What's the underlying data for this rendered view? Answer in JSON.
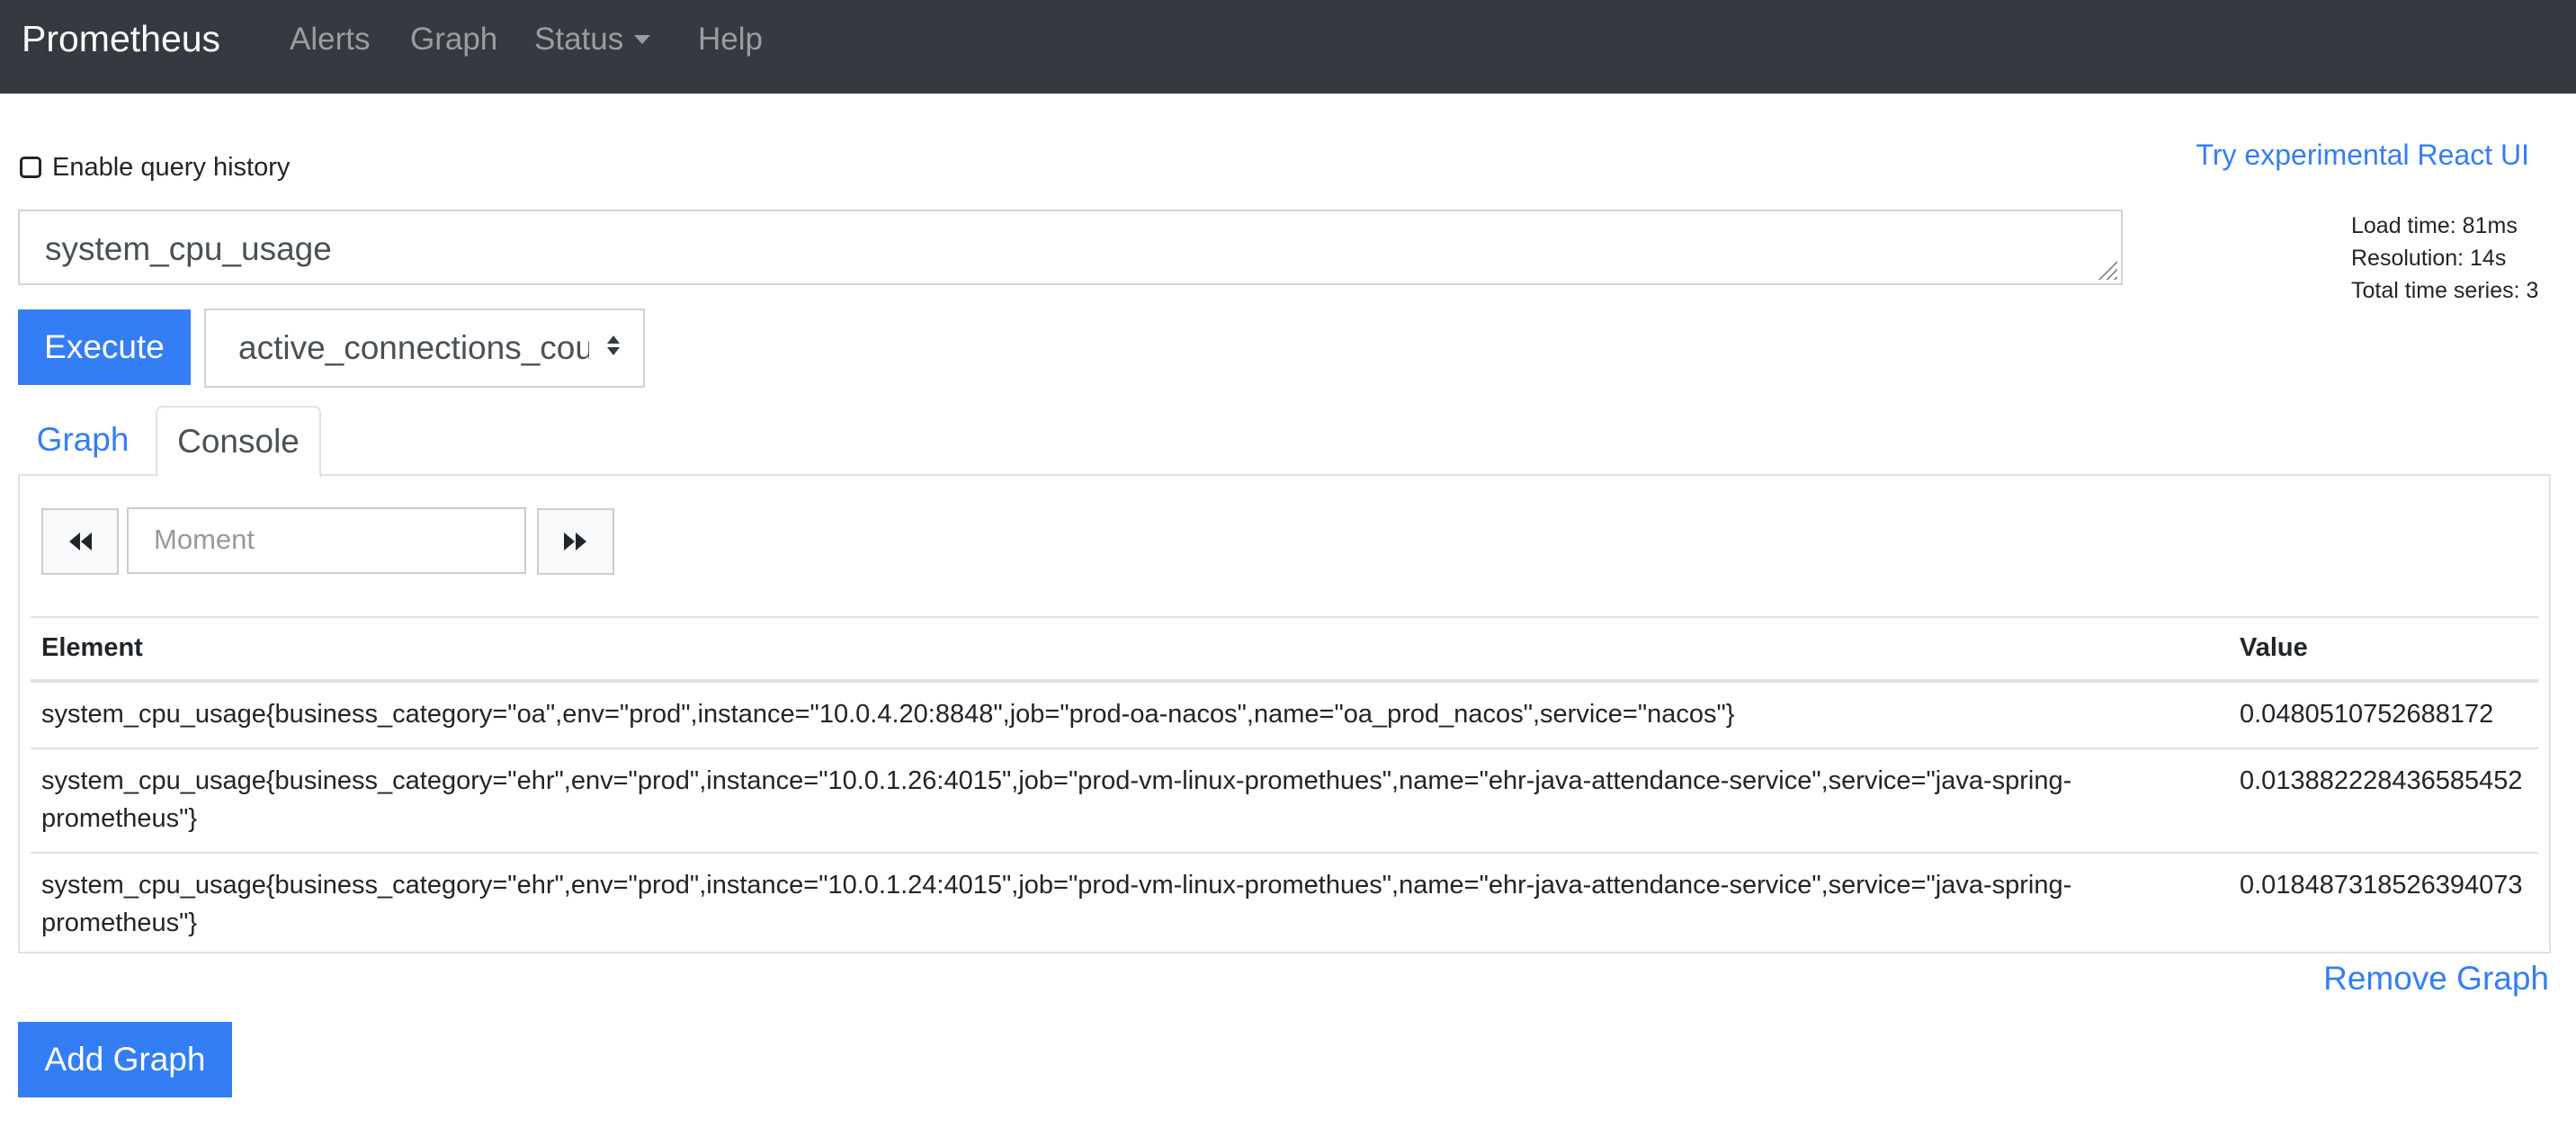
{
  "navbar": {
    "brand": "Prometheus",
    "items": [
      {
        "label": "Alerts"
      },
      {
        "label": "Graph"
      },
      {
        "label": "Status",
        "dropdown": true
      },
      {
        "label": "Help"
      }
    ]
  },
  "history": {
    "label": "Enable query history",
    "checked": false
  },
  "react_link": "Try experimental React UI",
  "query": {
    "value": "system_cpu_usage"
  },
  "stats": {
    "load_time": "Load time: 81ms",
    "resolution": "Resolution: 14s",
    "total_series": "Total time series: 3"
  },
  "execute_label": "Execute",
  "metric_select": {
    "selected": "active_connections_count"
  },
  "tabs": [
    {
      "label": "Graph",
      "active": false
    },
    {
      "label": "Console",
      "active": true
    }
  ],
  "console": {
    "moment_placeholder": "Moment",
    "back_icon": "fast-backward-icon",
    "forward_icon": "fast-forward-icon",
    "columns": [
      "Element",
      "Value"
    ],
    "rows": [
      {
        "element": "system_cpu_usage{business_category=\"oa\",env=\"prod\",instance=\"10.0.4.20:8848\",job=\"prod-oa-nacos\",name=\"oa_prod_nacos\",service=\"nacos\"}",
        "value": "0.0480510752688172"
      },
      {
        "element": "system_cpu_usage{business_category=\"ehr\",env=\"prod\",instance=\"10.0.1.26:4015\",job=\"prod-vm-linux-promethues\",name=\"ehr-java-attendance-service\",service=\"java-spring-prometheus\"}",
        "value": "0.013882228436585452"
      },
      {
        "element": "system_cpu_usage{business_category=\"ehr\",env=\"prod\",instance=\"10.0.1.24:4015\",job=\"prod-vm-linux-promethues\",name=\"ehr-java-attendance-service\",service=\"java-spring-prometheus\"}",
        "value": "0.018487318526394073"
      }
    ]
  },
  "remove_graph": "Remove Graph",
  "add_graph": "Add Graph",
  "colors": {
    "navbar": "#343a40",
    "primary": "#337ef4"
  }
}
